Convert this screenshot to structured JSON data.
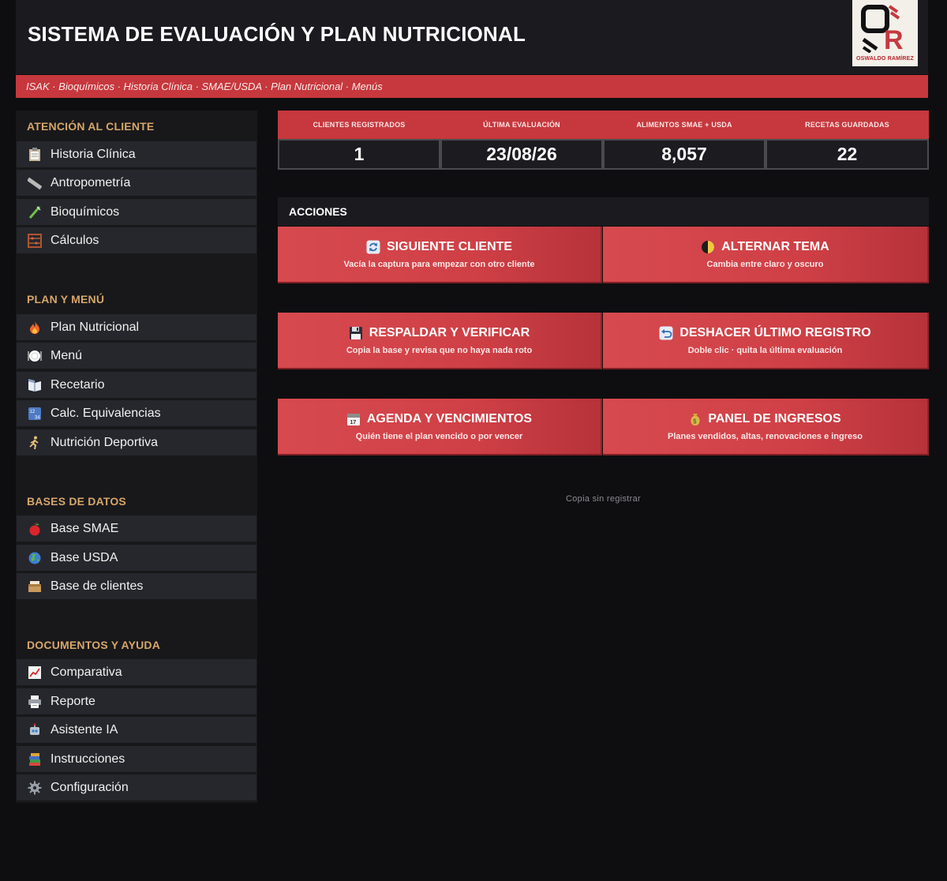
{
  "header": {
    "title": "SISTEMA DE EVALUACIÓN Y PLAN NUTRICIONAL",
    "logo_caption": "OSWALDO RAMÍREZ",
    "logo_letters": "OR"
  },
  "banner": {
    "text": "ISAK · Bioquímicos · Historia Clínica · SMAE/USDA · Plan Nutricional · Menús"
  },
  "sidebar": {
    "sections": [
      {
        "title": "ATENCIÓN AL CLIENTE",
        "items": [
          {
            "label": "Historia Clínica",
            "icon": "clipboard-icon"
          },
          {
            "label": "Antropometría",
            "icon": "ruler-icon"
          },
          {
            "label": "Bioquímicos",
            "icon": "test-tube-icon"
          },
          {
            "label": "Cálculos",
            "icon": "abacus-icon"
          }
        ]
      },
      {
        "title": "PLAN Y MENÚ",
        "items": [
          {
            "label": "Plan Nutricional",
            "icon": "fire-icon"
          },
          {
            "label": "Menú",
            "icon": "plate-icon"
          },
          {
            "label": "Recetario",
            "icon": "book-icon"
          },
          {
            "label": "Calc. Equivalencias",
            "icon": "numbers-icon"
          },
          {
            "label": "Nutrición Deportiva",
            "icon": "runner-icon"
          }
        ]
      },
      {
        "title": "BASES DE DATOS",
        "items": [
          {
            "label": "Base SMAE",
            "icon": "apple-icon"
          },
          {
            "label": "Base USDA",
            "icon": "globe-icon"
          },
          {
            "label": "Base de clientes",
            "icon": "card-box-icon"
          }
        ]
      },
      {
        "title": "DOCUMENTOS Y AYUDA",
        "items": [
          {
            "label": "Comparativa",
            "icon": "chart-up-icon"
          },
          {
            "label": "Reporte",
            "icon": "printer-icon"
          },
          {
            "label": "Asistente IA",
            "icon": "robot-icon"
          },
          {
            "label": "Instrucciones",
            "icon": "books-icon"
          },
          {
            "label": "Configuración",
            "icon": "gear-icon"
          }
        ]
      }
    ]
  },
  "stats": [
    {
      "label": "CLIENTES REGISTRADOS",
      "value": "1"
    },
    {
      "label": "ÚLTIMA EVALUACIÓN",
      "value": "23/08/26"
    },
    {
      "label": "ALIMENTOS SMAE + USDA",
      "value": "8,057"
    },
    {
      "label": "RECETAS GUARDADAS",
      "value": "22"
    }
  ],
  "actions": {
    "title": "ACCIONES",
    "buttons": [
      {
        "title": "SIGUIENTE CLIENTE",
        "subtitle": "Vacía la captura para empezar con otro cliente",
        "icon": "refresh-icon"
      },
      {
        "title": "ALTERNAR TEMA",
        "subtitle": "Cambia entre claro y oscuro",
        "icon": "moon-icon"
      },
      {
        "title": "RESPALDAR Y VERIFICAR",
        "subtitle": "Copia la base y revisa que no haya nada roto",
        "icon": "floppy-icon"
      },
      {
        "title": "DESHACER ÚLTIMO REGISTRO",
        "subtitle": "Doble clic · quita la última evaluación",
        "icon": "undo-icon"
      },
      {
        "title": "AGENDA Y VENCIMIENTOS",
        "subtitle": "Quién tiene el plan vencido o por vencer",
        "icon": "calendar-icon"
      },
      {
        "title": "PANEL DE INGRESOS",
        "subtitle": "Planes vendidos, altas, renovaciones e ingreso",
        "icon": "money-bag-icon"
      }
    ]
  },
  "footer": {
    "note": "Copia sin registrar"
  },
  "colors": {
    "accent": "#c6383d",
    "section_title": "#d6a66a",
    "background": "#0e0e10",
    "nav_item": "#26272c"
  }
}
